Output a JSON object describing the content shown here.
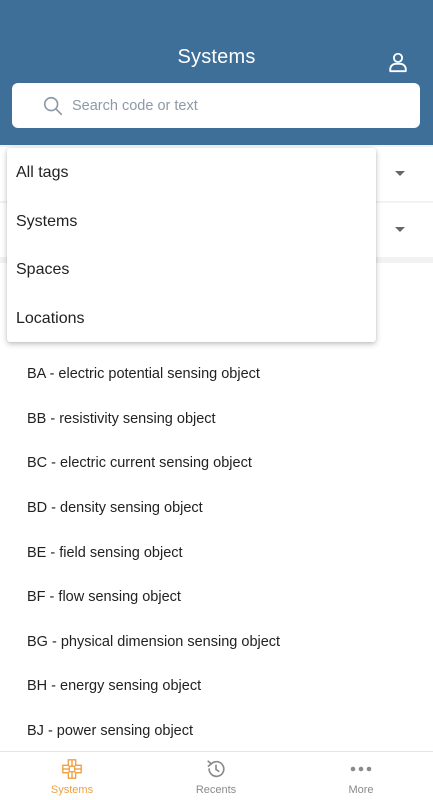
{
  "header": {
    "title": "Systems",
    "user_icon": "user-icon"
  },
  "search": {
    "placeholder": "Search code or text",
    "value": "",
    "icon": "search-icon"
  },
  "filters": [
    {
      "icon": "caret-down-icon"
    },
    {
      "icon": "caret-down-icon"
    }
  ],
  "dropdown": {
    "options": [
      "All tags",
      "Systems",
      "Spaces",
      "Locations"
    ]
  },
  "list": {
    "items": [
      "BA - electric potential sensing object",
      "BB - resistivity sensing object",
      "BC - electric current sensing object",
      "BD - density sensing object",
      "BE - field sensing object",
      "BF - flow sensing object",
      "BG - physical dimension sensing object",
      "BH - energy sensing object",
      "BJ - power sensing object"
    ]
  },
  "bottom_nav": {
    "items": [
      {
        "label": "Systems",
        "icon": "systems-icon",
        "active": true
      },
      {
        "label": "Recents",
        "icon": "history-icon",
        "active": false
      },
      {
        "label": "More",
        "icon": "more-dots-icon",
        "active": false
      }
    ]
  },
  "colors": {
    "header_bg": "#3d6f99",
    "accent": "#f0a040",
    "inactive": "#8a8a8a"
  }
}
